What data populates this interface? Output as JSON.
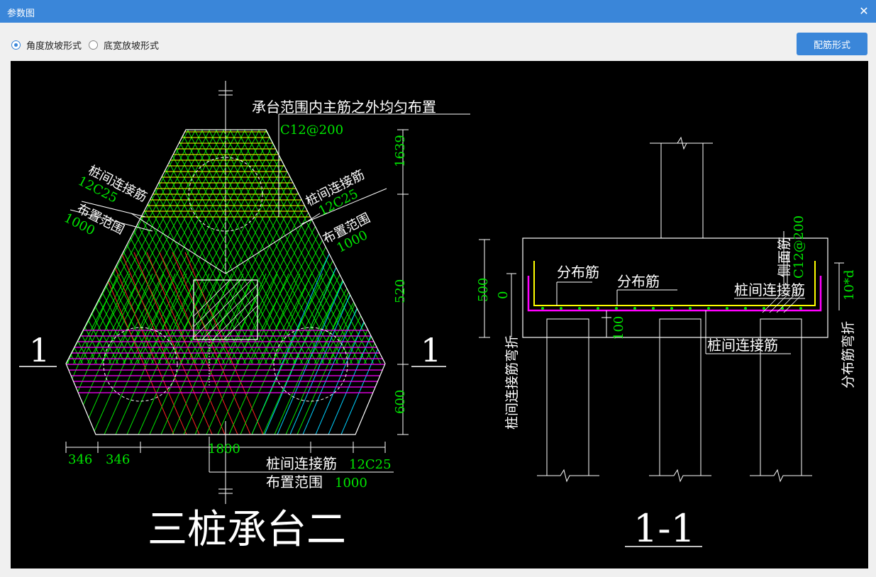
{
  "window": {
    "title": "参数图",
    "close_icon": "close-icon"
  },
  "options": {
    "radio_angle_label": "角度放坡形式",
    "radio_width_label": "底宽放坡形式",
    "selected": "角度放坡形式"
  },
  "toolbar": {
    "rebar_form_button": "配筋形式"
  },
  "drawing": {
    "plan": {
      "title": "三桩承台二",
      "top_note": "承台范围内主筋之外均匀布置",
      "top_spec": "C12@200",
      "left_label": "桩间连接筋",
      "left_spec": "12C25",
      "left_range_label": "布置范围",
      "left_range_val": "1000",
      "right_label": "桩间连接筋",
      "right_spec": "12C25",
      "right_range_label": "布置范围",
      "right_range_val": "1000",
      "bottom_label": "桩间连接筋",
      "bottom_spec": "12C25",
      "bottom_range_label": "布置范围",
      "bottom_range_val": "1000",
      "dim_right_top": "1639",
      "dim_right_mid": "520",
      "dim_right_bot": "600",
      "dim_bottom_a": "346",
      "dim_bottom_b": "346",
      "dim_bottom_total": "1800",
      "section_mark_left": "1",
      "section_mark_right": "1"
    },
    "section": {
      "title": "1-1",
      "dist_bar_1": "分布筋",
      "dist_bar_2": "分布筋",
      "pile_tie_bar_1": "桩间连接筋",
      "pile_tie_bar_2": "桩间连接筋",
      "side_bar_label": "侧面筋",
      "side_bar_spec": "C12@200",
      "dim_left_height": "500",
      "dim_left_zero": "0",
      "dim_cover": "100",
      "vertical_left_note": "桩间连接筋弯折",
      "vertical_right_note": "分布筋弯折",
      "bend_len": "10*d"
    }
  },
  "colors": {
    "green": "#00e600",
    "yellow": "#ffff00",
    "magenta": "#ff00ff",
    "red": "#ff2020",
    "cyan": "#00d0ff",
    "white": "#ffffff",
    "accent": "#3a86d9"
  }
}
